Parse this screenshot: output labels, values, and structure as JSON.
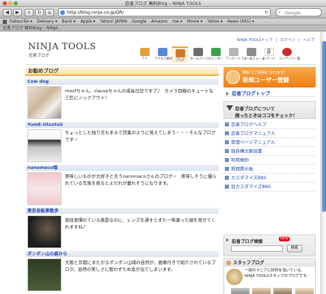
{
  "window": {
    "title": "忍者ブログ 無料Blog – NINJA TOOLS"
  },
  "toolbar": {
    "back": "◀",
    "forward": "▶",
    "add": "+",
    "url": "http://blog.ninja.co.jp/QR/",
    "reload": "↻",
    "search_placeholder": "Google"
  },
  "bookmarks": [
    "Fabourite ▾",
    "Delivery ▾",
    "Bank ▾",
    "Apple ▾",
    "Yahoo! JAPAN",
    "Google",
    "Amazon",
    "me ▾",
    "Movie ▾",
    "Yahoo ▾",
    "News (491) ▾"
  ],
  "tab": {
    "label": "忍者ブログ 無料Blog – NINJA..."
  },
  "header": {
    "logo": "NINJA TOOLS",
    "logo_sub": "忍者ブログ",
    "top_links": [
      "NINJA TOOLSトップ",
      "|",
      "ログイン",
      "|",
      "ヘルプ"
    ],
    "nav": [
      {
        "label": "アド",
        "color": "#e2a23a"
      },
      {
        "label": "アクセス解析",
        "color": "#5b8ad3"
      },
      {
        "label": "ブログ",
        "color": "#d07a2e"
      },
      {
        "label": "ホームページ",
        "color": "#6c6c6c"
      },
      {
        "label": "カレンダー",
        "color": "#3aa24a"
      },
      {
        "label": "アンケートフォーム",
        "color": "#b5b5b5"
      },
      {
        "label": "メールフォーム",
        "color": "#8d8d8d"
      },
      {
        "label": "β ページ",
        "color": "#ffffff"
      },
      {
        "label": "コンテンツ一覧",
        "color": "#cc2a2a"
      }
    ]
  },
  "main": {
    "section_title": "お勧めブログ",
    "entries": [
      {
        "title": "Cow dog",
        "desc": "moofちゃん、clauseちゃんの成長日記ですブ♪　カメラ目線のキュートな三匹にノックアウト！"
      },
      {
        "title": "YumE-UtsutsU",
        "desc": "ちょっとした独り言もまるで詩集のように見えてしまう・・・そんなブログです☆"
      },
      {
        "title": "nanomaco魂",
        "desc": "美味しいものが大好きと言うnanomacoさんのブログ☆　美味しそうに撮られている写真を見るとよだれが垂れそうになります。"
      },
      {
        "title": "東京自転車散歩",
        "desc": "普段見慣れている風景なのに、レンズを通すとまた一味違った顔を見せてくれますね♪"
      },
      {
        "title": "ポンポン山の森から",
        "desc": "大阪と京都にまたがるポンポン山域の自然が、画像付きで紹介されているブログ。自然の美しさに惹わずため息が出てしまいます。"
      }
    ]
  },
  "sidebar": {
    "banner_small": "無料でご利用になれます！",
    "banner_big": "新規ユーザー登録",
    "blog_top": "忍者ブログトップ",
    "help_line1": "忍者ブログについて",
    "help_line2": "困ったときはココをチェック！",
    "links": [
      "忍者ブログヘルプ",
      "忍者ブログマニュアル",
      "管理ページマニュアル",
      "独自構文解説書",
      "利用規約",
      "質問掲示板",
      "カスタマイズBBS",
      "旧カスタマイズBBS"
    ],
    "search_label": "忍者ブログ検索",
    "search_new": "NEW",
    "search_button": "検索",
    "staff_title": "スタッフブログ",
    "staff_desc": "一部のマニアに好評を頂いている、NINJA TOOLSスタッフのブログです。"
  }
}
